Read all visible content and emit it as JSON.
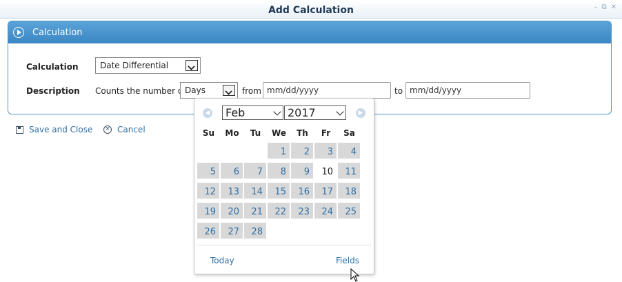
{
  "window": {
    "title": "Add Calculation",
    "controls": [
      "–",
      "⧉",
      "✕"
    ]
  },
  "panel": {
    "title": "Calculation",
    "calculation_label": "Calculation",
    "calculation_value": "Date Differential",
    "description_label": "Description",
    "desc_prefix": "Counts the number of",
    "unit_value": "Days",
    "from_label": "from",
    "from_placeholder": "mm/dd/yyyy",
    "to_label": "to",
    "to_placeholder": "mm/dd/yyyy"
  },
  "actions": {
    "save_label": "Save and Close",
    "cancel_label": "Cancel"
  },
  "calendar": {
    "month": "Feb",
    "year": "2017",
    "weekdays": [
      "Su",
      "Mo",
      "Tu",
      "We",
      "Th",
      "Fr",
      "Sa"
    ],
    "days": [
      "1",
      "2",
      "3",
      "4",
      "5",
      "6",
      "7",
      "8",
      "9",
      "10",
      "11",
      "12",
      "13",
      "14",
      "15",
      "16",
      "17",
      "18",
      "19",
      "20",
      "21",
      "22",
      "23",
      "24",
      "25",
      "26",
      "27",
      "28"
    ],
    "today_day": "10",
    "today_label": "Today",
    "fields_label": "Fields"
  },
  "colors": {
    "accent": "#4e93c6",
    "link": "#2f6fa6",
    "day_cell": "#d8d8d8"
  }
}
